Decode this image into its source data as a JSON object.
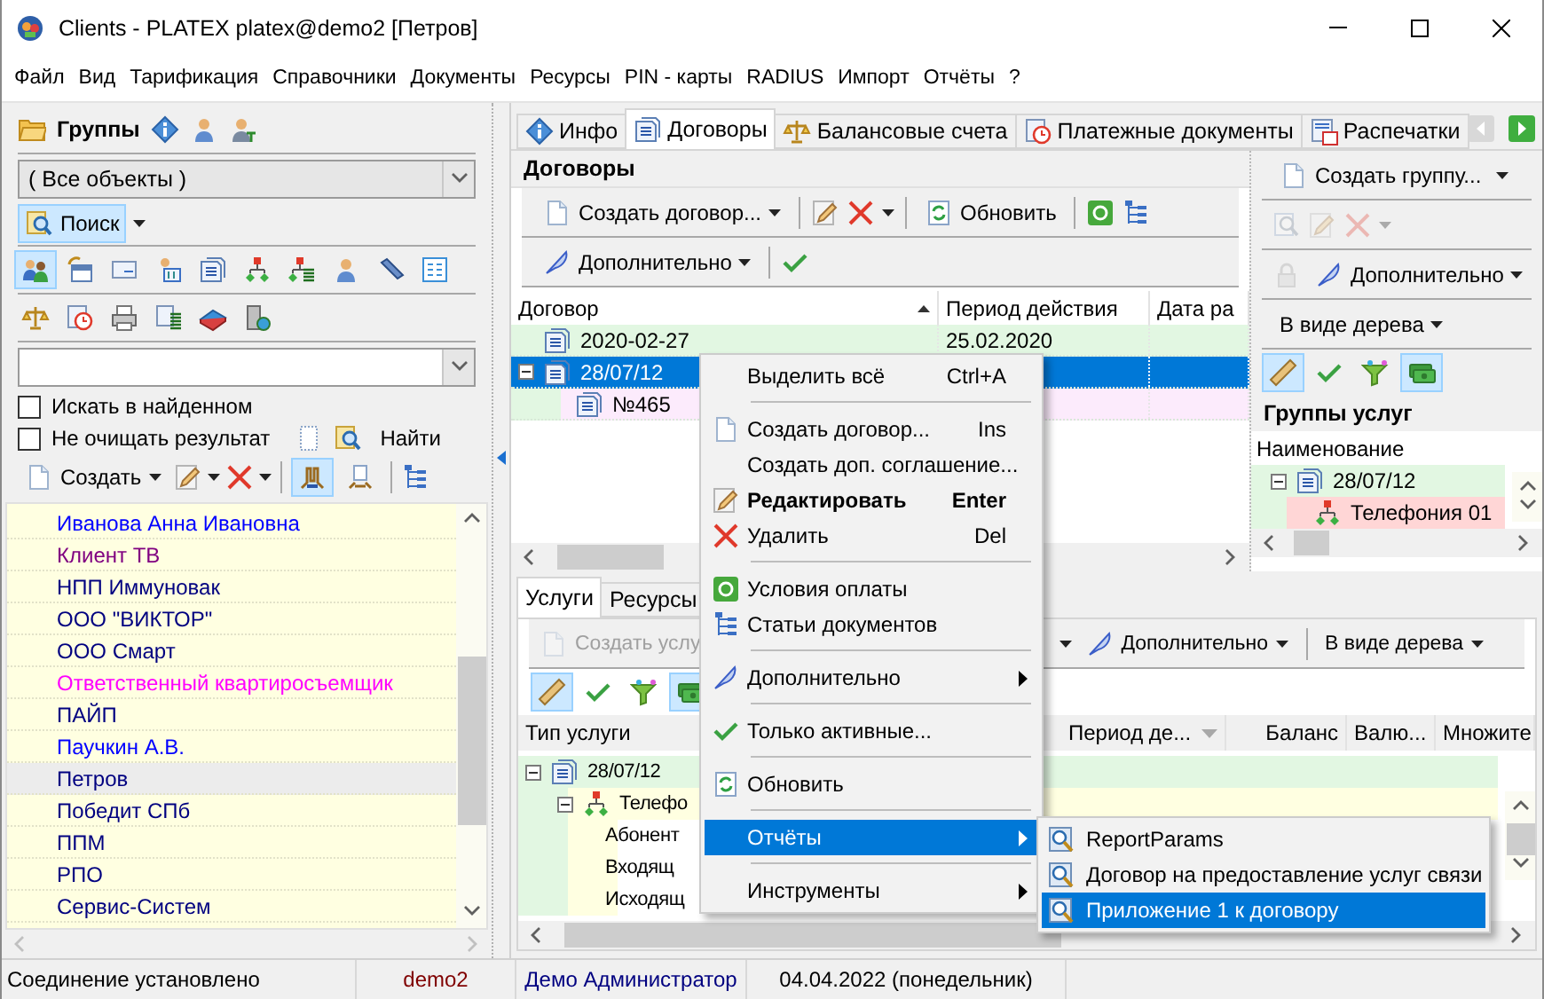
{
  "window": {
    "title": "Clients - PLATEX platex@demo2 [Петров]"
  },
  "menu": [
    "Файл",
    "Вид",
    "Тарификация",
    "Справочники",
    "Документы",
    "Ресурсы",
    "PIN - карты",
    "RADIUS",
    "Импорт",
    "Отчёты",
    "?"
  ],
  "left_panel": {
    "title": "Группы",
    "object_filter": {
      "value": "( Все объекты )"
    },
    "search_button": {
      "label": "Поиск",
      "pressed": true
    },
    "object_buttons": [
      {
        "pressed": true
      },
      {
        "pressed": false
      },
      {
        "pressed": false
      },
      {
        "pressed": false
      },
      {
        "pressed": false
      },
      {
        "pressed": false
      },
      {
        "pressed": false
      },
      {
        "pressed": false
      },
      {
        "pressed": false
      },
      {
        "pressed": false
      }
    ],
    "options": [
      {
        "label": "Искать в найденном",
        "checked": false
      },
      {
        "label": "Не очищать результат",
        "checked": false
      }
    ],
    "find_button": {
      "label": "Найти"
    },
    "create_button": {
      "label": "Создать"
    },
    "view_buttons": [
      {
        "pressed": true
      },
      {
        "pressed": false
      }
    ],
    "items": [
      {
        "label": "Иванова Анна Ивановна",
        "color": "#0000ff",
        "selected": false
      },
      {
        "label": "Клиент ТВ",
        "color": "#800080",
        "selected": false
      },
      {
        "label": "НПП Иммуновак",
        "color": "#000080",
        "selected": false
      },
      {
        "label": "ООО \"ВИКТОР\"",
        "color": "#000080",
        "selected": false
      },
      {
        "label": "ООО Смарт",
        "color": "#000080",
        "selected": false
      },
      {
        "label": "Ответственный квартиросъемщик",
        "color": "#ff00ff",
        "selected": false
      },
      {
        "label": "ПАЙП",
        "color": "#000080",
        "selected": false
      },
      {
        "label": "Паучкин А.В.",
        "color": "#0000ff",
        "selected": false
      },
      {
        "label": "Петров",
        "color": "#000080",
        "selected": true
      },
      {
        "label": "Победит СПб",
        "color": "#000080",
        "selected": false
      },
      {
        "label": "ППМ",
        "color": "#000080",
        "selected": false
      },
      {
        "label": "РПО",
        "color": "#000080",
        "selected": false
      },
      {
        "label": "Сервис-Систем",
        "color": "#000080",
        "selected": false
      }
    ]
  },
  "tabs": [
    {
      "label": "Инфо",
      "selected": false
    },
    {
      "label": "Договоры",
      "selected": true
    },
    {
      "label": "Балансовые счета",
      "selected": false
    },
    {
      "label": "Платежные документы",
      "selected": false
    },
    {
      "label": "Распечатки",
      "selected": false
    }
  ],
  "contracts": {
    "title": "Договоры",
    "create_button": "Создать договор...",
    "refresh_button": "Обновить",
    "more_button": "Дополнительно",
    "columns": [
      "Договор",
      "Период действия",
      "Дата ра"
    ],
    "rows": [
      {
        "name": "2020-02-27",
        "period": "25.02.2020",
        "selected": false
      },
      {
        "name": "28/07/12",
        "selected": true,
        "expanded": true,
        "children": [
          {
            "name": "№465",
            "selected": false
          }
        ]
      }
    ]
  },
  "groups_panel": {
    "create_button": "Создать группу...",
    "action_buttons": [
      {
        "disabled": true
      },
      {
        "disabled": true
      },
      {
        "disabled": true
      }
    ],
    "lock_button": {
      "disabled": true
    },
    "more_button": "Дополнительно",
    "view_button": "В виде дерева",
    "filter_buttons": [
      {
        "pressed": true
      },
      {
        "pressed": false
      },
      {
        "pressed": false
      },
      {
        "pressed": true
      }
    ],
    "title": "Группы услуг",
    "column": "Наименование",
    "tree": [
      {
        "name": "28/07/12",
        "expanded": true,
        "children": [
          {
            "name": "Телефония 01"
          }
        ]
      }
    ]
  },
  "services": {
    "tabs": [
      {
        "label": "Услуги",
        "selected": true
      },
      {
        "label": "Ресурсы",
        "selected": false
      }
    ],
    "create_button": {
      "label": "Создать услу",
      "disabled": true
    },
    "more_button": "Дополнительно",
    "view_button": "В виде дерева",
    "filter_buttons": [
      {
        "pressed": true
      },
      {
        "pressed": false
      },
      {
        "pressed": false
      },
      {
        "pressed": true
      }
    ],
    "columns": [
      "Тип услуги",
      "Период де...",
      "Баланс",
      "Валю...",
      "Множите"
    ],
    "tree": [
      {
        "name": "28/07/12",
        "expanded": true,
        "children": [
          {
            "name": "Телефо",
            "expanded": true,
            "children": [
              {
                "name": "Абонент"
              },
              {
                "name": "Входящ"
              },
              {
                "name": "Исходящ"
              }
            ]
          }
        ]
      }
    ]
  },
  "context_menu": {
    "items": [
      {
        "kind": "item",
        "label": "Выделить всё",
        "shortcut": "Ctrl+A",
        "selected": false,
        "default": false
      },
      {
        "kind": "separator"
      },
      {
        "kind": "item",
        "label": "Создать договор...",
        "shortcut": "Ins",
        "selected": false,
        "default": false
      },
      {
        "kind": "item",
        "label": "Создать доп. соглашение...",
        "selected": false,
        "default": false
      },
      {
        "kind": "item",
        "label": "Редактировать",
        "shortcut": "Enter",
        "selected": false,
        "default": true
      },
      {
        "kind": "item",
        "label": "Удалить",
        "shortcut": "Del",
        "selected": false,
        "default": false
      },
      {
        "kind": "separator"
      },
      {
        "kind": "item",
        "label": "Условия оплаты",
        "selected": false,
        "default": false
      },
      {
        "kind": "item",
        "label": "Статьи документов",
        "selected": false,
        "default": false
      },
      {
        "kind": "separator"
      },
      {
        "kind": "submenu",
        "label": "Дополнительно",
        "selected": false,
        "default": false
      },
      {
        "kind": "separator"
      },
      {
        "kind": "item",
        "label": "Только активные...",
        "selected": false,
        "default": false
      },
      {
        "kind": "separator"
      },
      {
        "kind": "item",
        "label": "Обновить",
        "selected": false,
        "default": false
      },
      {
        "kind": "separator"
      },
      {
        "kind": "submenu",
        "label": "Отчёты",
        "selected": true,
        "default": false
      },
      {
        "kind": "separator"
      },
      {
        "kind": "submenu",
        "label": "Инструменты",
        "selected": false,
        "default": false
      }
    ]
  },
  "reports_menu": {
    "items": [
      {
        "label": "ReportParams",
        "selected": false
      },
      {
        "label": "Договор на предоставление услуг связи",
        "selected": false
      },
      {
        "label": "Приложение 1 к договору",
        "selected": true
      }
    ]
  },
  "status_bar": [
    {
      "text": "Соединение установлено",
      "color": "#000000"
    },
    {
      "text": "demo2",
      "color": "#800000"
    },
    {
      "text": "Демо Администратор",
      "color": "#000080"
    },
    {
      "text": "04.04.2022 (понедельник)",
      "color": "#000000"
    }
  ]
}
